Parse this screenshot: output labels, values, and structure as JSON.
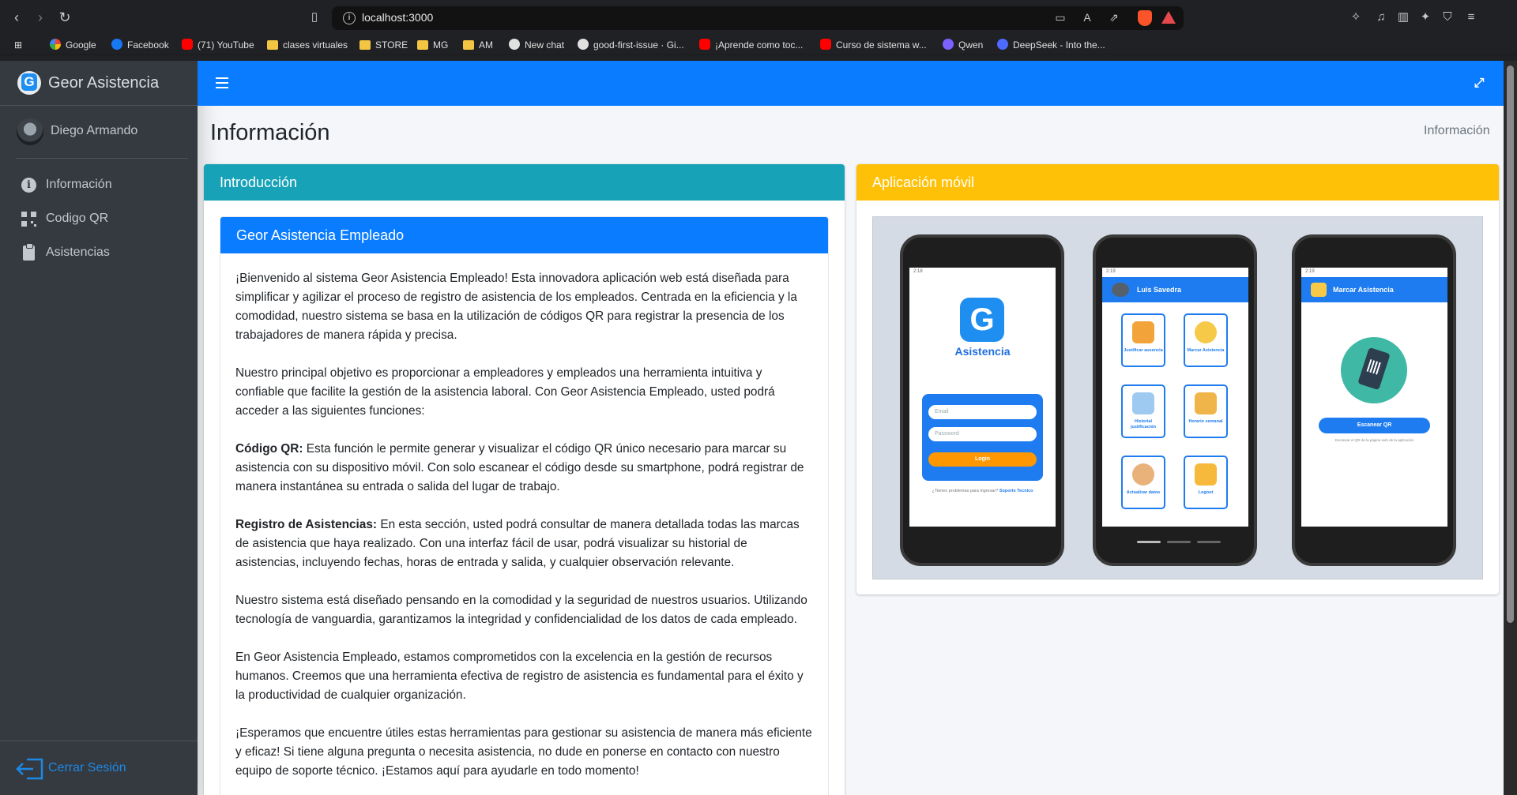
{
  "browser": {
    "url": "localhost:3000",
    "bookmarks": [
      {
        "label": "Google",
        "icon": "google-icon"
      },
      {
        "label": "Facebook",
        "icon": "facebook-icon"
      },
      {
        "label": "(71) YouTube",
        "icon": "youtube-icon"
      },
      {
        "label": "clases virtuales",
        "icon": "folder-icon"
      },
      {
        "label": "STORE",
        "icon": "folder-icon"
      },
      {
        "label": "MG",
        "icon": "folder-icon"
      },
      {
        "label": "AM",
        "icon": "folder-icon"
      },
      {
        "label": "New chat",
        "icon": "chat-icon"
      },
      {
        "label": "good-first-issue · Gi...",
        "icon": "github-icon"
      },
      {
        "label": "¡Aprende como toc...",
        "icon": "youtube-icon"
      },
      {
        "label": "Curso de sistema w...",
        "icon": "youtube-icon"
      },
      {
        "label": "Qwen",
        "icon": "qwen-icon"
      },
      {
        "label": "DeepSeek - Into the...",
        "icon": "deepseek-icon"
      }
    ]
  },
  "sidebar": {
    "brand": "Geor Asistencia",
    "user": "Diego Armando",
    "items": [
      {
        "label": "Información",
        "icon": "info-circle-icon"
      },
      {
        "label": "Codigo QR",
        "icon": "qrcode-icon"
      },
      {
        "label": "Asistencias",
        "icon": "clipboard-icon"
      }
    ],
    "logout": "Cerrar Sesión"
  },
  "page": {
    "title": "Información",
    "breadcrumb": "Información"
  },
  "intro": {
    "header": "Introducción",
    "inner_header": "Geor Asistencia Empleado",
    "p1": "¡Bienvenido al sistema Geor Asistencia Empleado! Esta innovadora aplicación web está diseñada para simplificar y agilizar el proceso de registro de asistencia de los empleados. Centrada en la eficiencia y la comodidad, nuestro sistema se basa en la utilización de códigos QR para registrar la presencia de los trabajadores de manera rápida y precisa.",
    "p2": "Nuestro principal objetivo es proporcionar a empleadores y empleados una herramienta intuitiva y confiable que facilite la gestión de la asistencia laboral. Con Geor Asistencia Empleado, usted podrá acceder a las siguientes funciones:",
    "p3_title": "Código QR:",
    "p3": " Esta función le permite generar y visualizar el código QR único necesario para marcar su asistencia con su dispositivo móvil. Con solo escanear el código desde su smartphone, podrá registrar de manera instantánea su entrada o salida del lugar de trabajo.",
    "p4_title": "Registro de Asistencias:",
    "p4": " En esta sección, usted podrá consultar de manera detallada todas las marcas de asistencia que haya realizado. Con una interfaz fácil de usar, podrá visualizar su historial de asistencias, incluyendo fechas, horas de entrada y salida, y cualquier observación relevante.",
    "p5": "Nuestro sistema está diseñado pensando en la comodidad y la seguridad de nuestros usuarios. Utilizando tecnología de vanguardia, garantizamos la integridad y confidencialidad de los datos de cada empleado.",
    "p6": "En Geor Asistencia Empleado, estamos comprometidos con la excelencia en la gestión de recursos humanos. Creemos que una herramienta efectiva de registro de asistencia es fundamental para el éxito y la productividad de cualquier organización.",
    "p7": "¡Esperamos que encuentre útiles estas herramientas para gestionar su asistencia de manera más eficiente y eficaz! Si tiene alguna pregunta o necesita asistencia, no dude en ponerse en contacto con nuestro equipo de soporte técnico. ¡Estamos aquí para ayudarle en todo momento!"
  },
  "mobile": {
    "header": "Aplicación móvil",
    "phone1": {
      "time": "2:18",
      "logo_letter": "G",
      "app_name": "Asistencia",
      "email_placeholder": "Email",
      "password_placeholder": "Password",
      "login": "Login",
      "support_text": "¿Tienes problemas para ingresar?",
      "support_link": "Soporte Tecnico"
    },
    "phone2": {
      "time": "2:19",
      "user": "Luis Savedra",
      "tiles": [
        "Justificar ausencia",
        "Marcar Asistencia",
        "Historial justificación",
        "Horario semanal",
        "Actualizar datos",
        "Logout"
      ]
    },
    "phone3": {
      "time": "2:19",
      "title": "Marcar Asistencia",
      "scan_button": "Escanear QR",
      "note": "Escanear el QR de la página web de la aplicación"
    }
  },
  "colors": {
    "navbar": "#0a7cff",
    "sidebar": "#343a40",
    "intro_header": "#17a2b8",
    "mobile_header": "#ffc107",
    "logout": "#1e88e5"
  }
}
